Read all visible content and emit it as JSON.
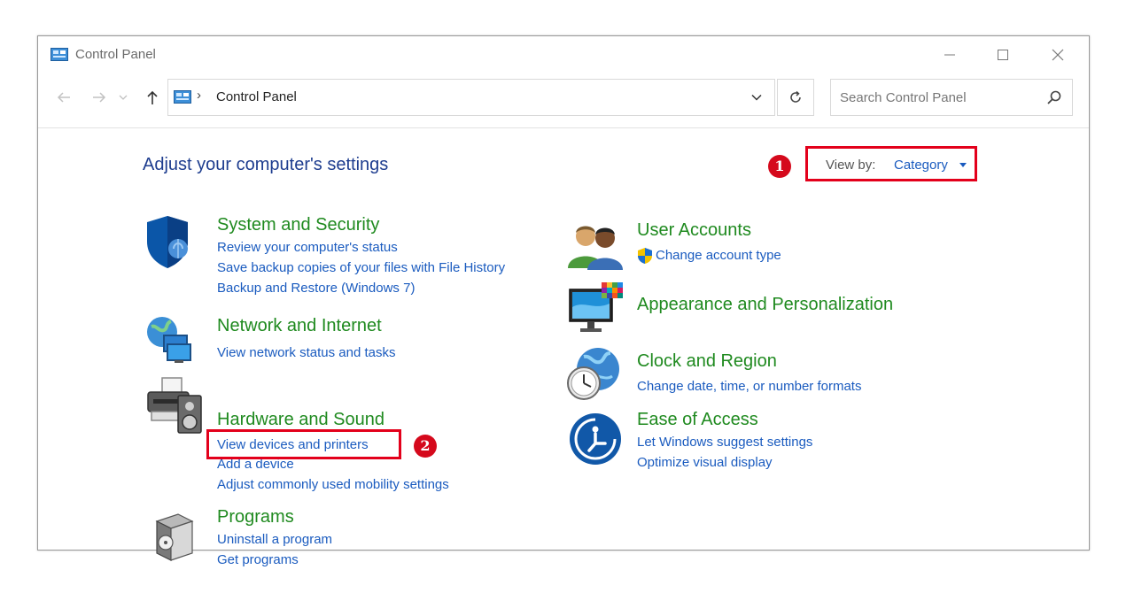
{
  "window": {
    "title": "Control Panel",
    "icon": "control-panel-icon",
    "buttons": [
      "minimize-icon",
      "maximize-icon",
      "close-icon"
    ]
  },
  "address_bar": {
    "separator": "›",
    "location": "Control Panel",
    "search_placeholder": "Search Control Panel"
  },
  "main": {
    "heading": "Adjust your computer's settings",
    "view_by_label": "View by:",
    "view_by_value": "Category",
    "callouts": [
      "1",
      "2"
    ]
  },
  "categories": {
    "system_security": {
      "title": "System and Security",
      "links": [
        "Review your computer's status",
        "Save backup copies of your files with File History",
        "Backup and Restore (Windows 7)"
      ]
    },
    "network_internet": {
      "title": "Network and Internet",
      "links": [
        "View network status and tasks"
      ]
    },
    "hardware_sound": {
      "title": "Hardware and Sound",
      "links": [
        "View devices and printers",
        "Add a device",
        "Adjust commonly used mobility settings"
      ]
    },
    "programs": {
      "title": "Programs",
      "links": [
        "Uninstall a program",
        "Get programs"
      ]
    },
    "user_accounts": {
      "title": "User Accounts",
      "links": [
        "Change account type"
      ]
    },
    "appearance": {
      "title": "Appearance and Personalization",
      "links": []
    },
    "clock_region": {
      "title": "Clock and Region",
      "links": [
        "Change date, time, or number formats"
      ]
    },
    "ease_access": {
      "title": "Ease of Access",
      "links": [
        "Let Windows suggest settings",
        "Optimize visual display"
      ]
    }
  },
  "colors": {
    "heading": "#1e3d8f",
    "category_title": "#1f8a1f",
    "link": "#1a5bbf",
    "highlight": "#e3001b"
  }
}
